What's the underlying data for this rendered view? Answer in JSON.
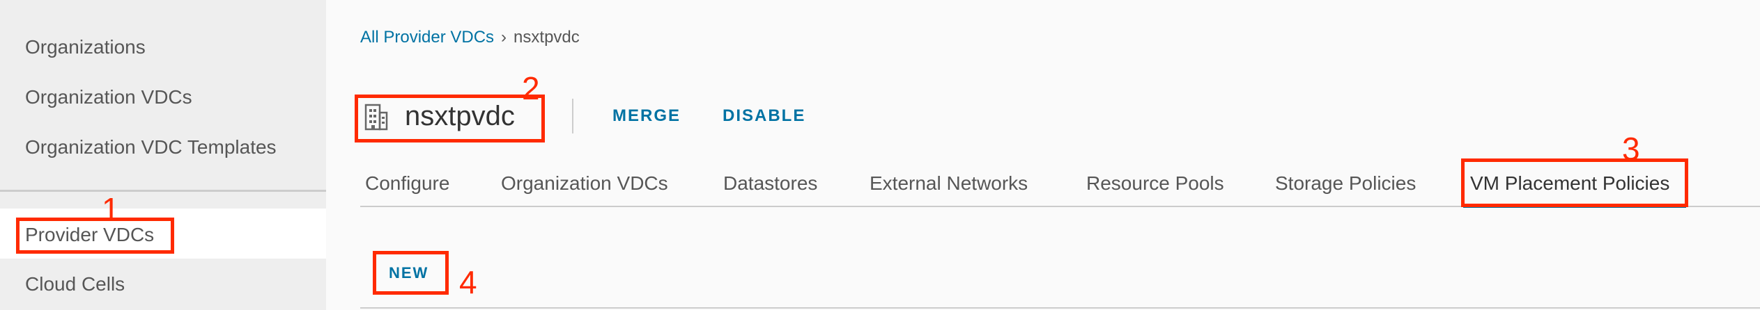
{
  "sidebar": {
    "items": [
      {
        "label": "Organizations"
      },
      {
        "label": "Organization VDCs"
      },
      {
        "label": "Organization VDC Templates"
      },
      {
        "label": "Provider VDCs",
        "selected": true
      },
      {
        "label": "Cloud Cells"
      }
    ]
  },
  "breadcrumb": {
    "root": "All Provider VDCs",
    "separator": "›",
    "current": "nsxtpvdc"
  },
  "header": {
    "icon": "building-icon",
    "title": "nsxtpvdc",
    "actions": {
      "merge": "MERGE",
      "disable": "DISABLE"
    }
  },
  "tabs": [
    {
      "label": "Configure"
    },
    {
      "label": "Organization VDCs"
    },
    {
      "label": "Datastores"
    },
    {
      "label": "External Networks"
    },
    {
      "label": "Resource Pools"
    },
    {
      "label": "Storage Policies"
    },
    {
      "label": "VM Placement Policies",
      "active": true
    }
  ],
  "toolbar": {
    "new_label": "NEW"
  },
  "annotations": {
    "n1": "1",
    "n2": "2",
    "n3": "3",
    "n4": "4"
  },
  "colors": {
    "accent": "#0072a3",
    "annotation": "#ff2a00",
    "sidebar_bg": "#eeeeee"
  }
}
